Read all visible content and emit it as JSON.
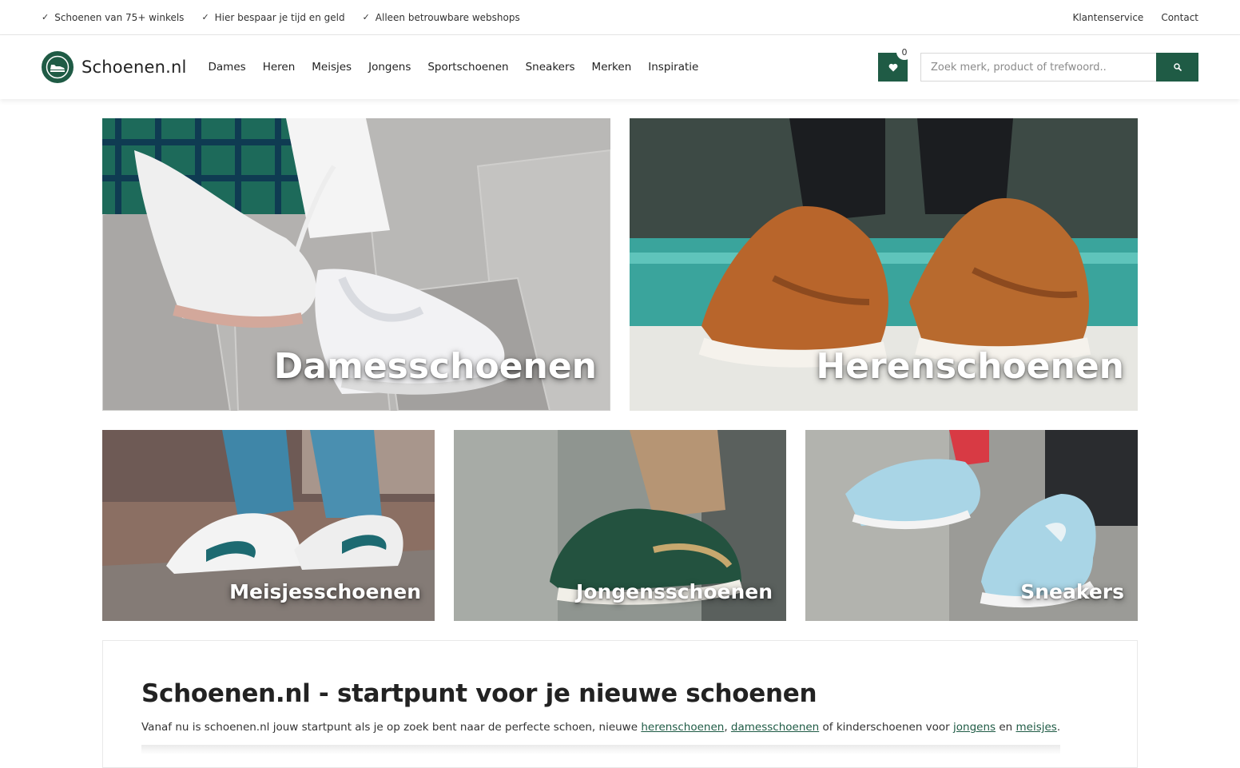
{
  "usps": [
    "Schoenen van 75+ winkels",
    "Hier bespaar je tijd en geld",
    "Alleen betrouwbare webshops"
  ],
  "top_links": {
    "service": "Klantenservice",
    "contact": "Contact"
  },
  "brand": {
    "name": "Schoenen.nl",
    "accent": "#1f5b45"
  },
  "nav": [
    "Dames",
    "Heren",
    "Meisjes",
    "Jongens",
    "Sportschoenen",
    "Sneakers",
    "Merken",
    "Inspiratie"
  ],
  "wishlist": {
    "count": "0"
  },
  "search": {
    "placeholder": "Zoek merk, product of trefwoord.."
  },
  "tiles": [
    {
      "label": "Damesschoenen"
    },
    {
      "label": "Herenschoenen"
    },
    {
      "label": "Meisjesschoenen"
    },
    {
      "label": "Jongensschoenen"
    },
    {
      "label": "Sneakers"
    }
  ],
  "intro": {
    "title": "Schoenen.nl - startpunt voor je nieuwe schoenen",
    "text_before": "Vanaf nu is schoenen.nl jouw startpunt als je op zoek bent naar de perfecte schoen, nieuwe ",
    "link_heren": "herenschoenen",
    "comma": ", ",
    "link_dames": "damesschoenen",
    "text_middle": " of kinderschoenen voor ",
    "link_jongens": "jongens",
    "text_and": " en ",
    "link_meisjes": "meisjes",
    "text_end": "."
  }
}
